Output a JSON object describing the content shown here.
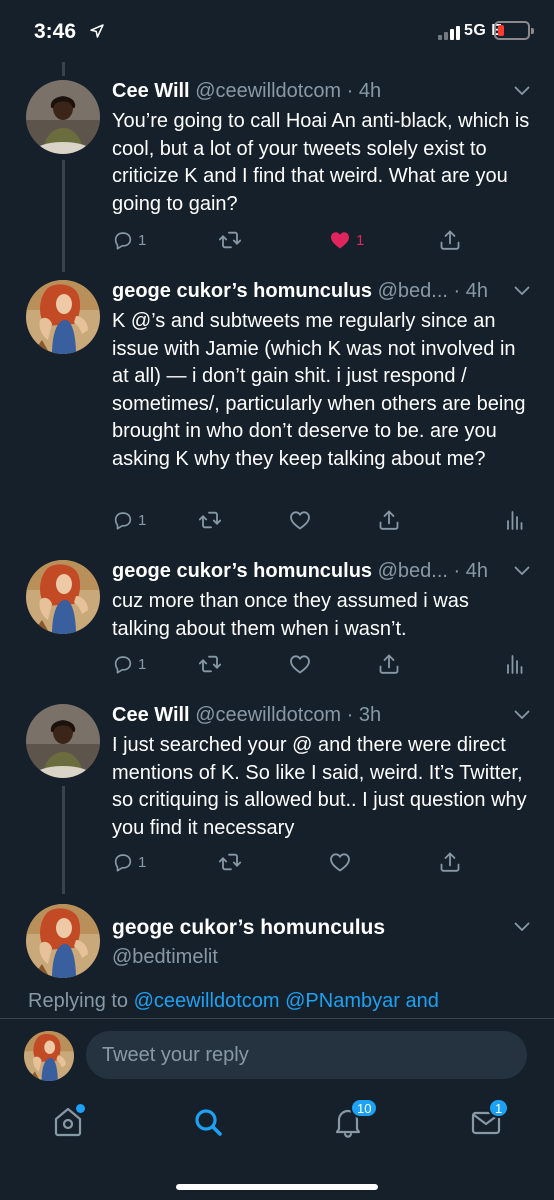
{
  "status_bar": {
    "time": "3:46",
    "network": "5G E"
  },
  "tweets": [
    {
      "name": "Cee Will",
      "handle": "@ceewilldotcom",
      "time": "4h",
      "text": "You’re going to call Hoai An anti-black, which is cool, but a lot of your tweets solely exist to criticize K and I find that weird. What are you going to gain?",
      "replies": "1",
      "likes": "1",
      "liked": true
    },
    {
      "name": "geoge cukor’s homunculus",
      "handle": "@bed...",
      "time": "4h",
      "text": "K @’s and subtweets me regularly since an issue with Jamie (which K was not involved in at all) — i don’t gain shit. i just respond / sometimes/, particularly when others are being brought in who don’t deserve to be. are you asking K why they keep talking about me?",
      "replies": "1"
    },
    {
      "name": "geoge cukor’s homunculus",
      "handle": "@bed...",
      "time": "4h",
      "text": "cuz more than once they assumed i was talking about them when i wasn’t.",
      "replies": "1"
    },
    {
      "name": "Cee Will",
      "handle": "@ceewilldotcom",
      "time": "3h",
      "text": "I just searched your @ and there were direct mentions of K. So like I said, weird. It’s Twitter, so critiquing is allowed but.. I just question why you find it necessary",
      "replies": "1"
    }
  ],
  "focused_tweet": {
    "name": "geoge cukor’s homunculus",
    "handle": "@bedtimelit"
  },
  "replying_to": {
    "prefix": "Replying to",
    "mention_1": "@ceewilldotcom",
    "mention_2": "@PNambyar",
    "suffix": "and"
  },
  "reply_box": {
    "placeholder": "Tweet your reply"
  },
  "tab_bar": {
    "notifications_badge": "10",
    "messages_badge": "1"
  },
  "colors": {
    "background": "#15202b",
    "accent": "#1da1f2",
    "like": "#e0245e",
    "secondary_text": "#8899a6",
    "divider": "#38444d"
  },
  "icons": [
    "location-arrow-icon",
    "reply-icon",
    "retweet-icon",
    "heart-icon",
    "share-icon",
    "analytics-icon",
    "chevron-down-icon",
    "home-icon",
    "search-icon",
    "bell-icon",
    "mail-icon"
  ]
}
